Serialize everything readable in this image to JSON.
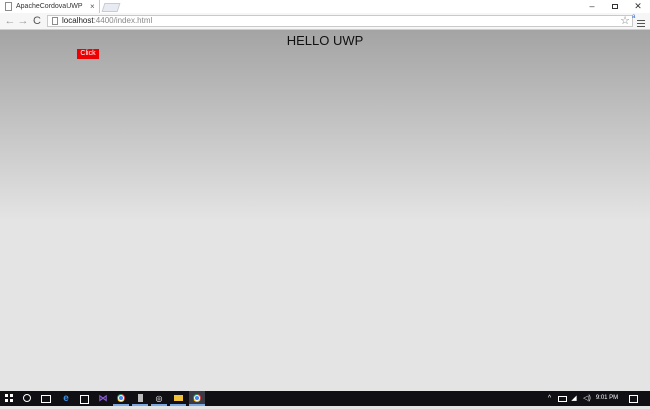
{
  "browser": {
    "tab_title": "ApacheCordovaUWP",
    "tab_close": "×",
    "window_controls": {
      "minimize": "–",
      "close": "✕"
    },
    "nav": {
      "back": "←",
      "forward": "→",
      "reload": "C"
    },
    "address": {
      "host": "localhost",
      "path": ":4400/index.html"
    },
    "star_icon": "☆",
    "extension_badge": "a"
  },
  "page": {
    "heading": "HELLO UWP",
    "button_label": "Click",
    "button_color": "#ee0000",
    "gradient_top": "#a4a4a4",
    "gradient_bottom": "#e4e4e4"
  },
  "taskbar": {
    "edge_glyph": "e",
    "vs_glyph": "⋈",
    "steam_glyph": "◎",
    "tray_up": "^",
    "network_glyph": "◢",
    "volume_glyph": "◁)",
    "time": "9:01 PM"
  }
}
